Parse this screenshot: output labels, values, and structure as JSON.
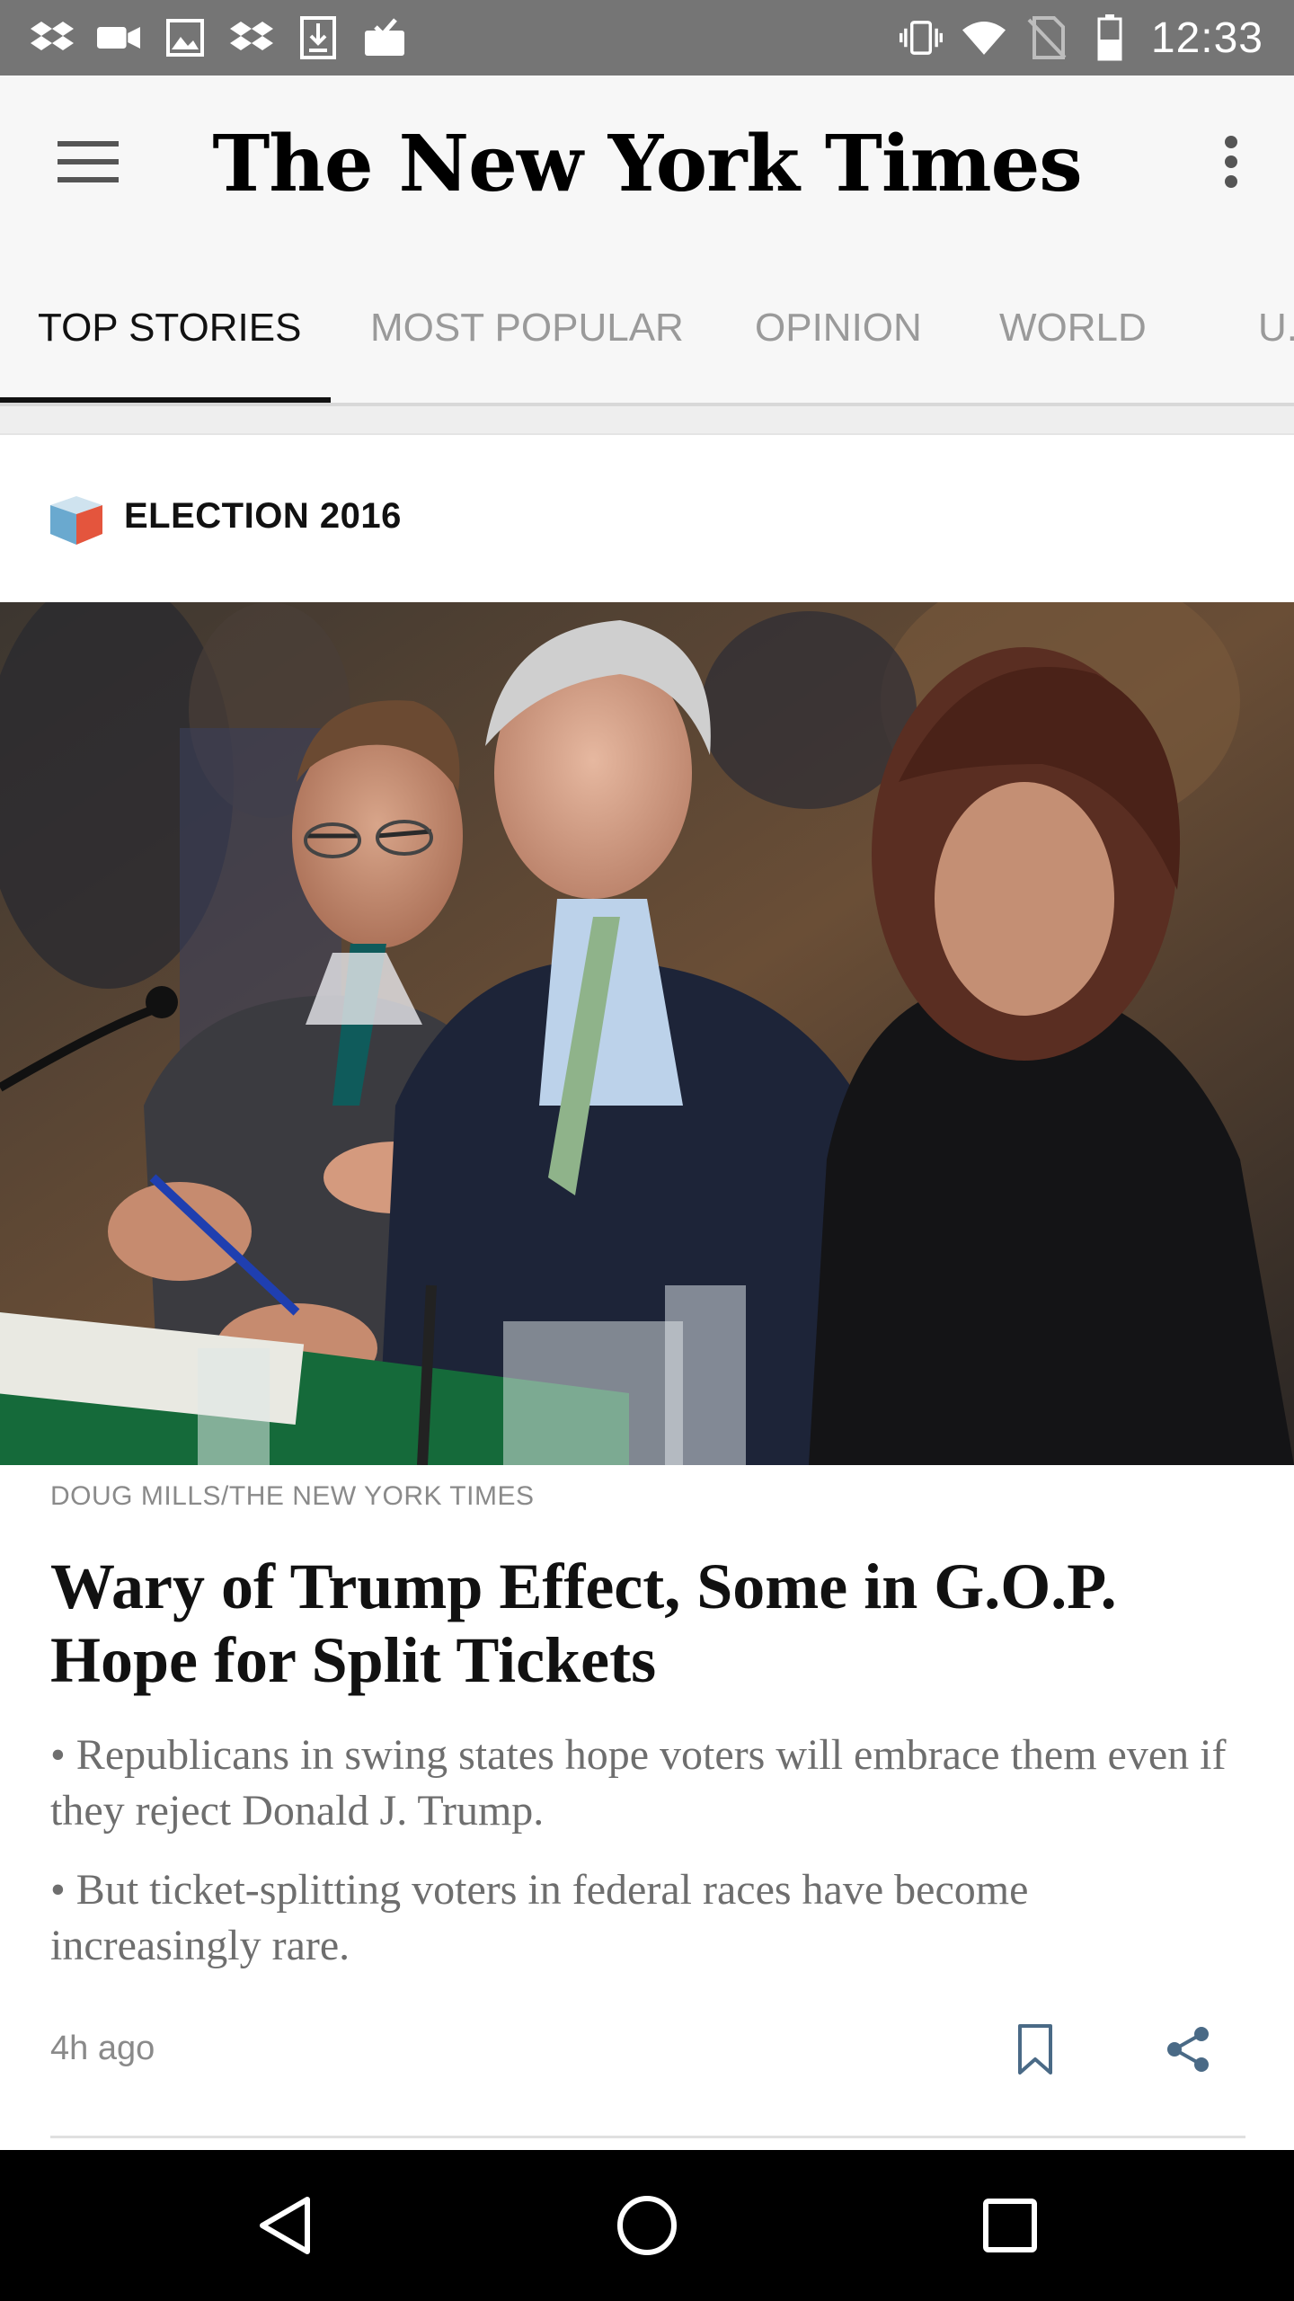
{
  "status_bar": {
    "time": "12:33",
    "left_icons": [
      "dropbox-icon",
      "video-icon",
      "image-icon",
      "dropbox-icon",
      "download-icon",
      "inbox-icon"
    ],
    "right_icons": [
      "vibrate-icon",
      "wifi-icon",
      "no-sim-icon",
      "battery-icon"
    ]
  },
  "app_bar": {
    "logo_text": "The New York Times"
  },
  "tabs": [
    {
      "label": "TOP STORIES",
      "active": true
    },
    {
      "label": "MOST POPULAR",
      "active": false
    },
    {
      "label": "OPINION",
      "active": false
    },
    {
      "label": "WORLD",
      "active": false
    },
    {
      "label": "U.",
      "active": false
    }
  ],
  "section": {
    "label": "ELECTION 2016"
  },
  "article": {
    "photo_credit": "DOUG MILLS/THE NEW YORK TIMES",
    "headline": "Wary of Trump Effect, Some in G.O.P. Hope for Split Tickets",
    "bullets": [
      "• Republicans in swing states hope voters will embrace them even if they reject Donald J. Trump.",
      "• But ticket-splitting voters in federal races have become increasingly rare."
    ],
    "timestamp": "4h ago"
  },
  "colors": {
    "status_bar": "#757575",
    "app_bar": "#f7f7f7",
    "active_tab": "#111111",
    "inactive_tab": "#9a9a9a",
    "action_icon": "#4a6a86",
    "nav_bar": "#000000"
  }
}
